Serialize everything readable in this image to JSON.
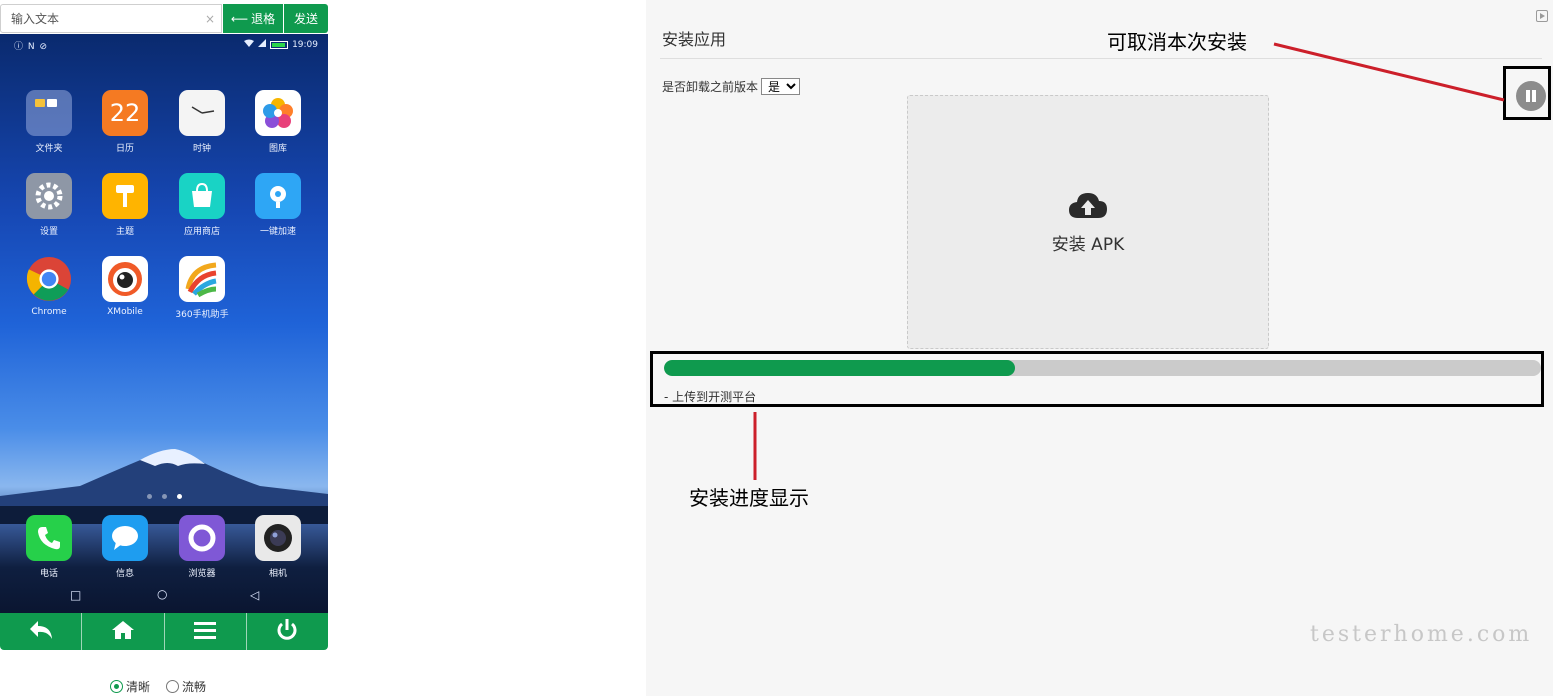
{
  "phone": {
    "text_input": {
      "placeholder": "输入文本",
      "value": ""
    },
    "clear_glyph": "×",
    "backspace_label": "退格",
    "send_label": "发送",
    "status_bar": {
      "left_icons": "ⓘ N ⊘",
      "time": "19:09"
    },
    "apps": [
      {
        "label": "文件夹",
        "icon": "folder-icon"
      },
      {
        "label": "日历",
        "icon": "calendar-icon",
        "icon_text": "22"
      },
      {
        "label": "时钟",
        "icon": "clock-icon"
      },
      {
        "label": "图库",
        "icon": "gallery-icon"
      },
      {
        "label": "设置",
        "icon": "settings-icon"
      },
      {
        "label": "主题",
        "icon": "theme-icon"
      },
      {
        "label": "应用商店",
        "icon": "app-store-icon"
      },
      {
        "label": "一键加速",
        "icon": "speed-up-icon"
      },
      {
        "label": "Chrome",
        "icon": "chrome-icon"
      },
      {
        "label": "XMobile",
        "icon": "xmobile-icon"
      },
      {
        "label": "360手机助手",
        "icon": "360-assistant-icon"
      }
    ],
    "dock": [
      {
        "label": "电话",
        "icon": "phone-icon"
      },
      {
        "label": "信息",
        "icon": "messages-icon"
      },
      {
        "label": "浏览器",
        "icon": "browser-icon"
      },
      {
        "label": "相机",
        "icon": "camera-icon"
      }
    ],
    "android_nav": {
      "recent": "□",
      "home": "○",
      "back": "◁"
    },
    "bottom_buttons": [
      "back-arrow-icon",
      "home-icon",
      "menu-icon",
      "power-icon"
    ],
    "quality": {
      "options": [
        "清晰",
        "流畅"
      ],
      "selected": "清晰"
    }
  },
  "install": {
    "title": "安装应用",
    "uninstall_label": "是否卸载之前版本",
    "uninstall_selected": "是",
    "upload_label": "安装 APK",
    "progress_fraction": 0.4,
    "progress_text": "- 上传到开测平台",
    "watermark": "testerhome.com"
  },
  "annotations": {
    "cancel_note": "可取消本次安装",
    "progress_note": "安装进度显示",
    "line_color": "#cc1f2a"
  },
  "colors": {
    "accent": "#0f9a4e",
    "progress_track": "#cbcbcb",
    "panel_bg": "#f6f6f6"
  }
}
